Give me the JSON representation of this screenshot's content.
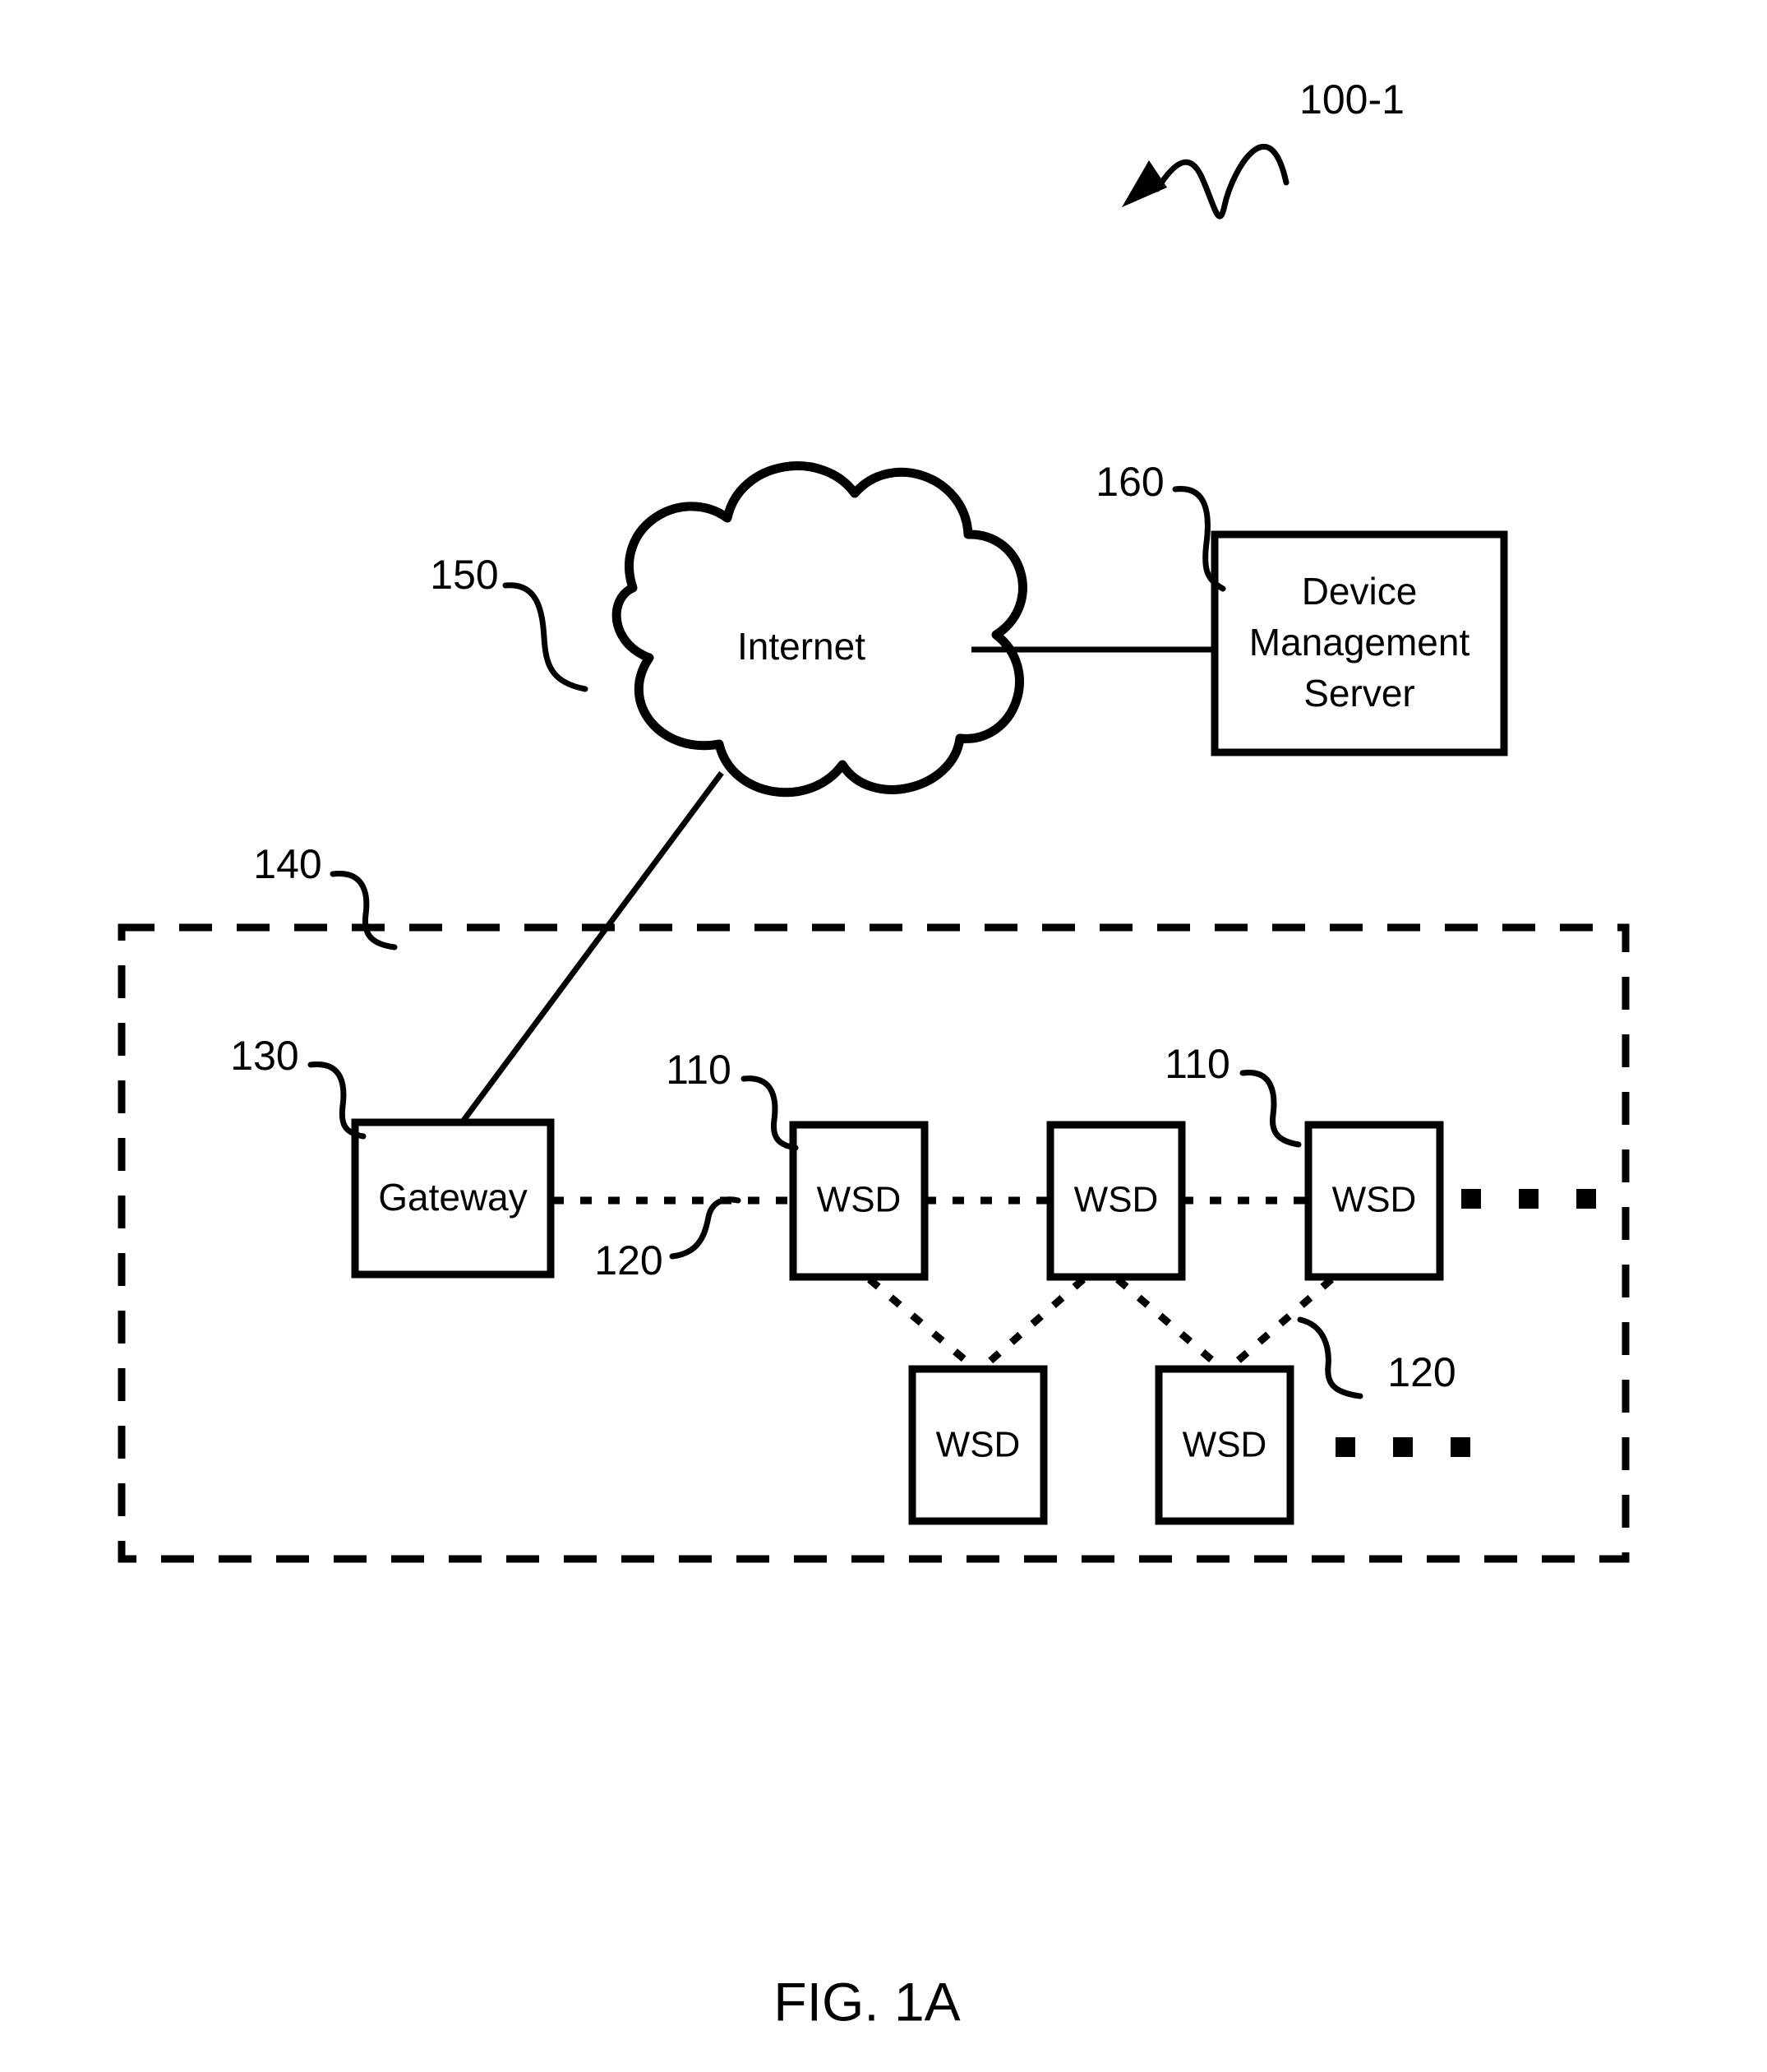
{
  "figure": {
    "caption": "FIG. 1A",
    "system_reference": "100-1"
  },
  "nodes": {
    "cloud": {
      "label": "Internet",
      "reference": "150"
    },
    "server": {
      "label_line1": "Device",
      "label_line2": "Management",
      "label_line3": "Server",
      "reference": "160"
    },
    "gateway": {
      "label": "Gateway",
      "reference": "130"
    },
    "network_boundary": {
      "reference": "140"
    },
    "wsd_top": [
      {
        "label": "WSD",
        "reference": "110"
      },
      {
        "label": "WSD",
        "reference": ""
      },
      {
        "label": "WSD",
        "reference": "110"
      }
    ],
    "wsd_bottom": [
      {
        "label": "WSD",
        "reference": ""
      },
      {
        "label": "WSD",
        "reference": ""
      }
    ]
  },
  "links": {
    "wireless_reference_left": "120",
    "wireless_reference_right": "120"
  },
  "colors": {
    "line": "#000000",
    "background": "#ffffff"
  }
}
